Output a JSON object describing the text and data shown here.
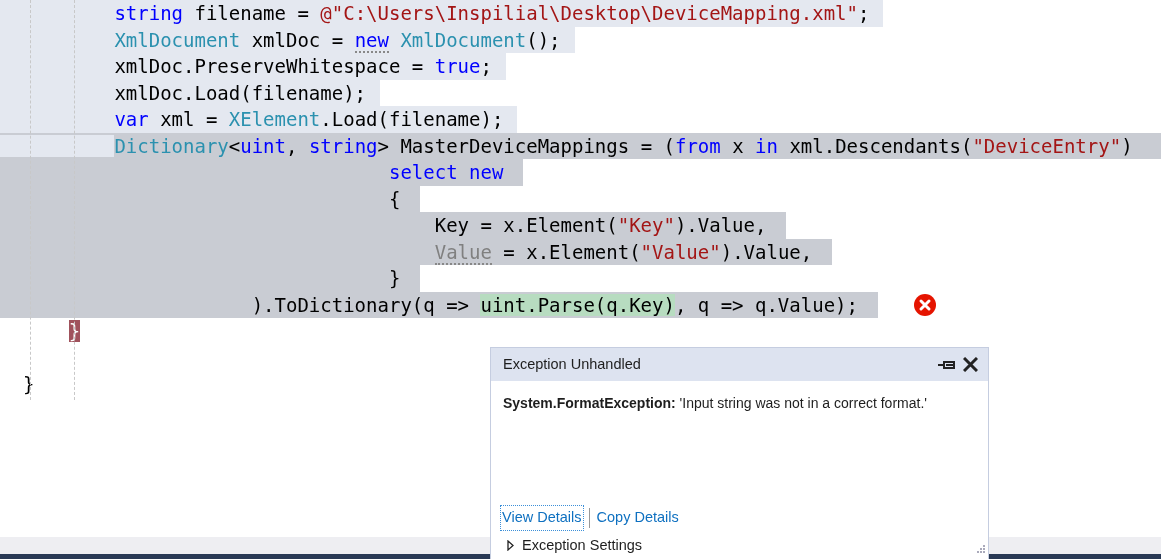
{
  "editor": {
    "lines": [
      {
        "kind": "pale",
        "tokens": [
          {
            "text": "          string",
            "kind": "kw"
          },
          {
            "text": " filename = "
          },
          {
            "text": "@\"C:\\Users\\Inspilial\\Desktop\\DeviceMapping.xml\"",
            "kind": "str"
          },
          {
            "text": ";"
          }
        ]
      },
      {
        "kind": "pale",
        "tokens": [
          {
            "text": "          XmlDocument",
            "kind": "type"
          },
          {
            "text": " xmlDoc = "
          },
          {
            "text": "new",
            "kind": "kw",
            "suggestion": true
          },
          {
            "text": " XmlDocument",
            "kind": "type"
          },
          {
            "text": "();"
          }
        ]
      },
      {
        "kind": "pale",
        "tokens": [
          {
            "text": "          xmlDoc.PreserveWhitespace = "
          },
          {
            "text": "true",
            "kind": "kw"
          },
          {
            "text": ";"
          }
        ]
      },
      {
        "kind": "pale",
        "tokens": [
          {
            "text": "          xmlDoc.Load(filename);"
          }
        ]
      },
      {
        "kind": "pale",
        "tokens": [
          {
            "text": "          var",
            "kind": "kw"
          },
          {
            "text": " xml = "
          },
          {
            "text": "XElement",
            "kind": "type"
          },
          {
            "text": ".Load(filename);"
          }
        ]
      },
      {
        "kind": "mixed",
        "tokens": [
          {
            "text": "          Dictionary",
            "kind": "type"
          },
          {
            "text": "<"
          },
          {
            "text": "uint",
            "kind": "kw"
          },
          {
            "text": ", "
          },
          {
            "text": "string",
            "kind": "kw"
          },
          {
            "text": "> MasterDeviceMappings = ("
          },
          {
            "text": "from",
            "kind": "kw"
          },
          {
            "text": " x "
          },
          {
            "text": "in",
            "kind": "kw"
          },
          {
            "text": " xml.Descendants("
          },
          {
            "text": "\"DeviceEntry\"",
            "kind": "str"
          },
          {
            "text": ")"
          }
        ]
      },
      {
        "kind": "dark",
        "tokens": [
          {
            "text": "                                  select",
            "kind": "kw"
          },
          {
            "text": " new",
            "kind": "kw"
          }
        ]
      },
      {
        "kind": "dark",
        "tokens": [
          {
            "text": "                                  {"
          }
        ]
      },
      {
        "kind": "dark",
        "tokens": [
          {
            "text": "                                      Key = x.Element("
          },
          {
            "text": "\"Key\"",
            "kind": "str"
          },
          {
            "text": ").Value,"
          }
        ]
      },
      {
        "kind": "dark",
        "tokens": [
          {
            "text": "                                      Value",
            "kind": "dim",
            "suggestion": true
          },
          {
            "text": " = x.Element("
          },
          {
            "text": "\"Value\"",
            "kind": "str"
          },
          {
            "text": ").Value,"
          }
        ]
      },
      {
        "kind": "dark",
        "tokens": [
          {
            "text": "                                  }"
          }
        ]
      },
      {
        "kind": "dark",
        "error": true,
        "tokens": [
          {
            "text": "                      ).ToDictionary(q => "
          },
          {
            "text": "uint.Parse(q.Key)",
            "kind": "highlight"
          },
          {
            "text": ", q => q.Value);"
          }
        ]
      },
      {
        "kind": "plain",
        "tokens": [
          {
            "text": "      }",
            "kind": "brace"
          }
        ]
      },
      {
        "kind": "plain"
      },
      {
        "kind": "plain",
        "tokens": [
          {
            "text": "  }"
          }
        ]
      }
    ]
  },
  "exception_popup": {
    "title": "Exception Unhandled",
    "message": "**System.FormatException:** 'Input string was not in a correct format.'",
    "links": [
      {
        "label": "View Details",
        "focused": true
      },
      {
        "label": "Copy Details",
        "focused": false
      }
    ],
    "settings": {
      "label": "Exception Settings",
      "expanded": false
    }
  }
}
